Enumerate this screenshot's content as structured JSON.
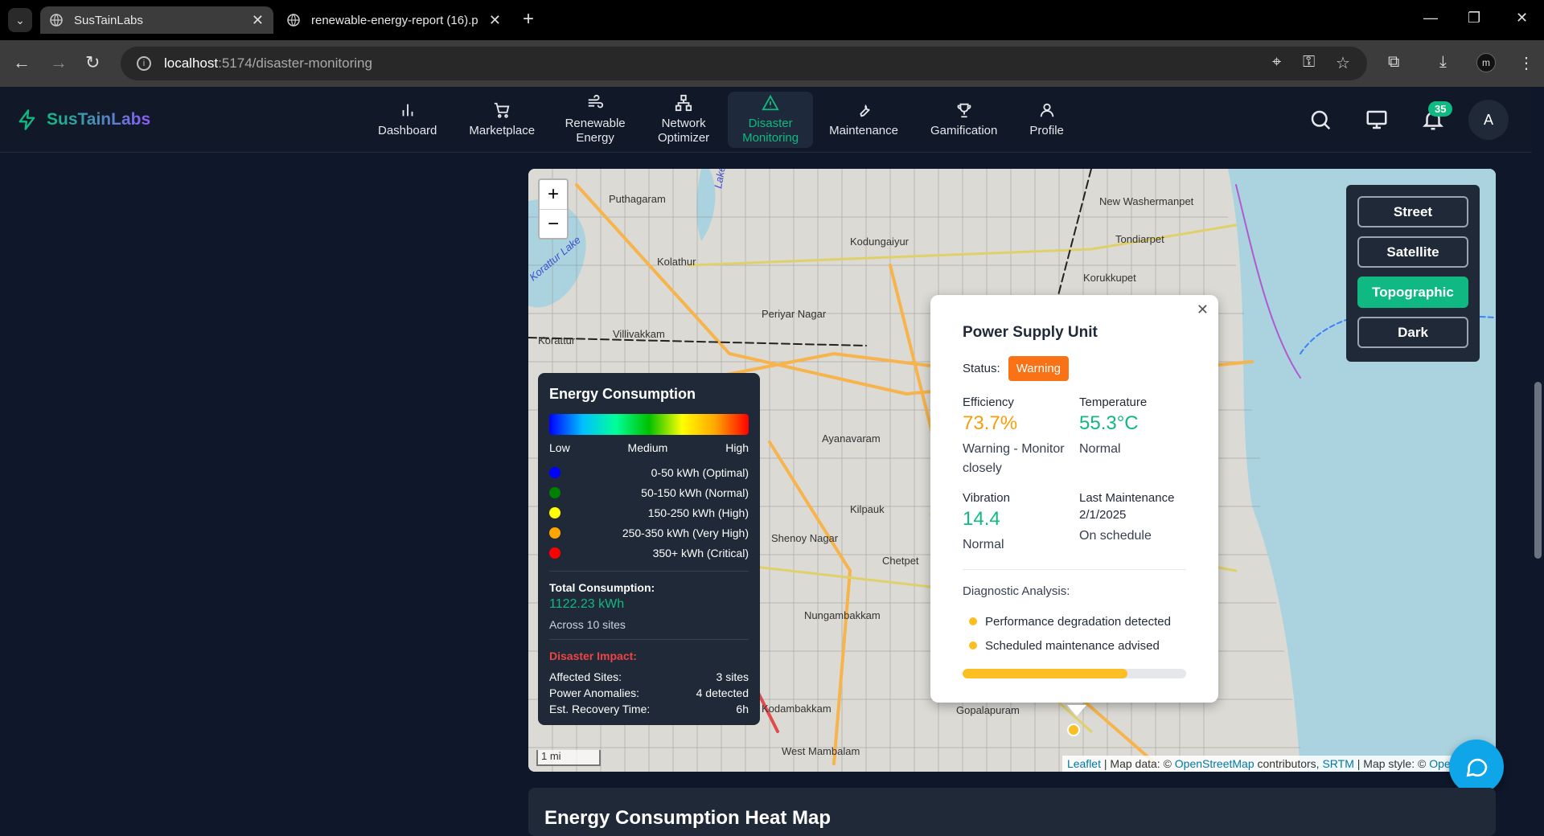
{
  "browser": {
    "tabs": [
      {
        "title": "SusTainLabs",
        "active": true
      },
      {
        "title": "renewable-energy-report (16).p",
        "active": false
      }
    ],
    "url_host": "localhost",
    "url_path": ":5174/disaster-monitoring"
  },
  "header": {
    "brand": "SusTainLabs",
    "nav": [
      {
        "label": "Dashboard",
        "icon": "bar-chart-icon"
      },
      {
        "label": "Marketplace",
        "icon": "cart-icon"
      },
      {
        "label": "Renewable Energy",
        "icon": "wind-icon"
      },
      {
        "label": "Network Optimizer",
        "icon": "network-icon"
      },
      {
        "label": "Disaster Monitoring",
        "icon": "alert-triangle-icon",
        "active": true
      },
      {
        "label": "Maintenance",
        "icon": "wrench-icon"
      },
      {
        "label": "Gamification",
        "icon": "trophy-icon"
      },
      {
        "label": "Profile",
        "icon": "user-icon"
      }
    ],
    "notification_count": "35",
    "avatar_initial": "A"
  },
  "map": {
    "zoom_in": "+",
    "zoom_out": "−",
    "layers": [
      "Street",
      "Satellite",
      "Topographic",
      "Dark"
    ],
    "active_layer": "Topographic",
    "place_labels": [
      "Puthagaram",
      "Kodungaiyur",
      "New Washermanpet",
      "Tondiarpet",
      "Korukkupet",
      "Kolathur",
      "Periyar Nagar",
      "Korattur",
      "Villivakkam",
      "Ayanavaram",
      "Kilpauk",
      "Shenoy Nagar",
      "Chetpet",
      "Nungambakkam",
      "Kodambakkam",
      "West Mambalam",
      "Gopalapuram",
      "Korattur Lake",
      "Lake"
    ],
    "scale": "1 mi",
    "attribution": {
      "leaflet": "Leaflet",
      "text1": " | Map data: © ",
      "osm": "OpenStreetMap",
      "text2": " contributors, ",
      "srtm": "SRTM",
      "text3": " | Map style: © ",
      "style": "OpenT"
    }
  },
  "legend": {
    "title": "Energy Consumption",
    "gradient_labels": [
      "Low",
      "Medium",
      "High"
    ],
    "ranges": [
      {
        "label": "0-50 kWh (Optimal)",
        "color": "#0000ff"
      },
      {
        "label": "50-150 kWh (Normal)",
        "color": "#008000"
      },
      {
        "label": "150-250 kWh (High)",
        "color": "#ffff00"
      },
      {
        "label": "250-350 kWh (Very High)",
        "color": "#ffa500"
      },
      {
        "label": "350+ kWh (Critical)",
        "color": "#ff0000"
      }
    ],
    "total_label": "Total Consumption:",
    "total_value": "1122.23 kWh",
    "total_sites": "Across 10 sites",
    "disaster_title": "Disaster Impact:",
    "disaster_rows": [
      {
        "label": "Affected Sites:",
        "value": "3 sites"
      },
      {
        "label": "Power Anomalies:",
        "value": "4 detected"
      },
      {
        "label": "Est. Recovery Time:",
        "value": "6h"
      }
    ]
  },
  "popup": {
    "title": "Power Supply Unit",
    "status_label": "Status:",
    "status_value": "Warning",
    "efficiency_label": "Efficiency",
    "efficiency_value": "73.7%",
    "efficiency_note": "Warning - Monitor closely",
    "temperature_label": "Temperature",
    "temperature_value": "55.3°C",
    "temperature_note": "Normal",
    "vibration_label": "Vibration",
    "vibration_value": "14.4",
    "vibration_note": "Normal",
    "maintenance_label": "Last Maintenance",
    "maintenance_date": "2/1/2025",
    "maintenance_note": "On schedule",
    "diagnostic_label": "Diagnostic Analysis:",
    "diagnostics": [
      "Performance degradation detected",
      "Scheduled maintenance advised"
    ],
    "health_fraction": 0.737,
    "colors": {
      "warning": "#f59e0b",
      "normal": "#10b981"
    }
  },
  "next_section_title": "Energy Consumption Heat Map"
}
